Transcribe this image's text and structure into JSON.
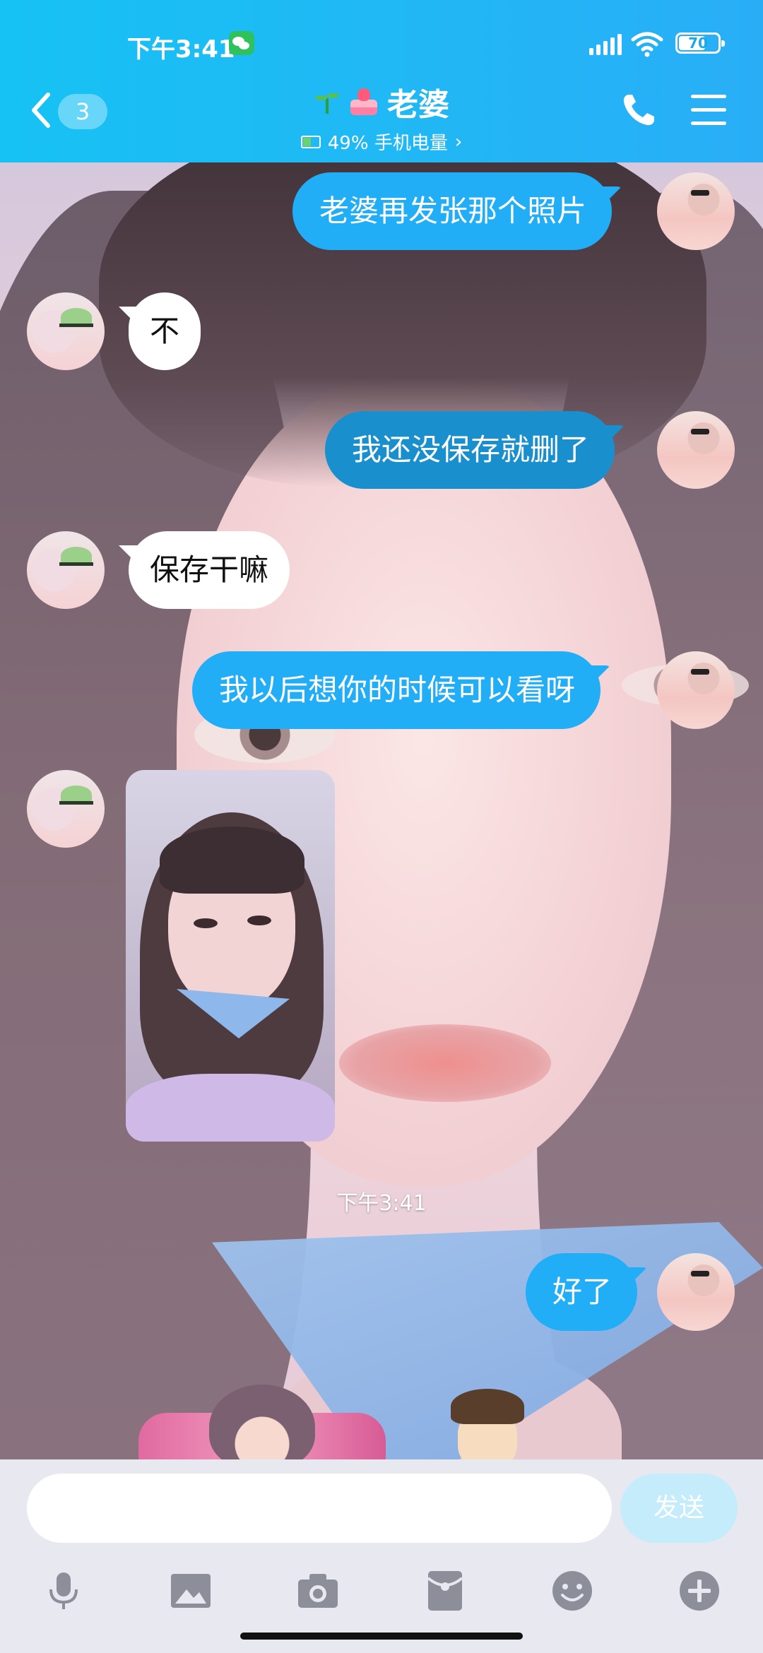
{
  "status_bar": {
    "time": "下午3:41",
    "battery": "70",
    "battery_level": 0.7
  },
  "header": {
    "back_badge": "3",
    "title": "老婆",
    "subtitle": "49% 手机电量",
    "subtitle_chevron": "›"
  },
  "messages": [
    {
      "side": "out",
      "text": "老婆再发张那个照片"
    },
    {
      "side": "in",
      "text": "不"
    },
    {
      "side": "out",
      "text": "我还没保存就删了"
    },
    {
      "side": "in",
      "text": "保存干嘛"
    },
    {
      "side": "out",
      "text": "我以后想你的时候可以看呀"
    },
    {
      "side": "in",
      "type": "photo"
    },
    {
      "side": "out",
      "text": "好了"
    }
  ],
  "time_divider": "下午3:41",
  "input": {
    "placeholder": "",
    "value": "",
    "send_label": "发送"
  },
  "toolbar_icons": [
    "microphone-icon",
    "image-icon",
    "camera-icon",
    "red-packet-icon",
    "emoji-icon",
    "plus-icon"
  ],
  "colors": {
    "header_bg": "#1cbaf4",
    "bubble_out": "#21aef6",
    "bubble_in": "#ffffff",
    "send_button_disabled": "#c5ecfb"
  }
}
